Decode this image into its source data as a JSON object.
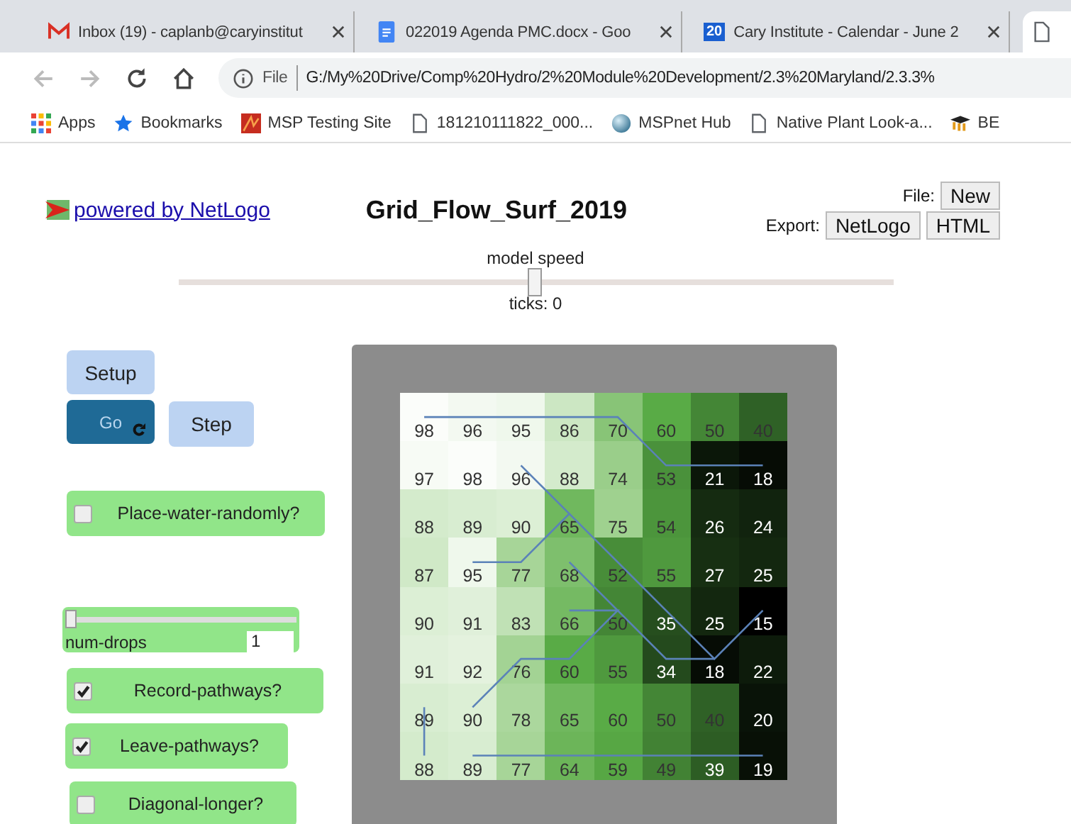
{
  "browser": {
    "tabs": [
      {
        "title": "Inbox (19) - caplanb@caryinstitut",
        "selected": false
      },
      {
        "title": "022019 Agenda PMC.docx - Goo",
        "selected": false
      },
      {
        "title": "Cary Institute - Calendar - June 2",
        "icon_text": "20",
        "selected": false
      },
      {
        "selected": true
      }
    ],
    "address": {
      "scheme": "File",
      "url": "G:/My%20Drive/Comp%20Hydro/2%20Module%20Development/2.3%20Maryland/2.3.3%"
    },
    "bookmarks": [
      {
        "label": "Apps"
      },
      {
        "label": "Bookmarks"
      },
      {
        "label": "MSP Testing Site"
      },
      {
        "label": "181210111822_000..."
      },
      {
        "label": "MSPnet Hub"
      },
      {
        "label": "Native Plant Look-a..."
      },
      {
        "label": "BE"
      }
    ]
  },
  "netlogo": {
    "powered_link": "powered by NetLogo",
    "title": "Grid_Flow_Surf_2019",
    "file_label": "File:",
    "file_buttons": [
      "New"
    ],
    "export_label": "Export:",
    "export_buttons": [
      "NetLogo",
      "HTML"
    ],
    "speed": {
      "label": "model speed",
      "level": 0.5
    },
    "ticks": "ticks: 0",
    "widgets": [
      {
        "kind": "button",
        "label": "Setup",
        "forever": false,
        "running": false
      },
      {
        "kind": "button",
        "label": "Go",
        "forever": true,
        "running": true
      },
      {
        "kind": "button",
        "label": "Step",
        "forever": false,
        "running": false
      },
      {
        "kind": "switch",
        "label": "Place-water-randomly?",
        "on": false
      },
      {
        "kind": "slider",
        "label": "num-drops",
        "value": "1",
        "level": 0
      },
      {
        "kind": "switch",
        "label": "Record-pathways?",
        "on": true
      },
      {
        "kind": "switch",
        "label": "Leave-pathways?",
        "on": true
      },
      {
        "kind": "switch",
        "label": "Diagonal-longer?",
        "on": false
      }
    ],
    "view": {
      "rows": [
        [
          "98",
          "96",
          "95",
          "86",
          "70",
          "60",
          "50",
          "40"
        ],
        [
          "97",
          "98",
          "96",
          "88",
          "74",
          "53",
          "21",
          "18"
        ],
        [
          "88",
          "89",
          "90",
          "65",
          "75",
          "54",
          "26",
          "24"
        ],
        [
          "87",
          "95",
          "77",
          "68",
          "52",
          "55",
          "27",
          "25"
        ],
        [
          "90",
          "91",
          "83",
          "66",
          "50",
          "35",
          "25",
          "15"
        ],
        [
          "91",
          "92",
          "76",
          "60",
          "55",
          "34",
          "18",
          "22"
        ],
        [
          "89",
          "90",
          "78",
          "65",
          "60",
          "50",
          "40",
          "20"
        ],
        [
          "88",
          "89",
          "77",
          "64",
          "59",
          "49",
          "39",
          "19"
        ]
      ]
    }
  }
}
